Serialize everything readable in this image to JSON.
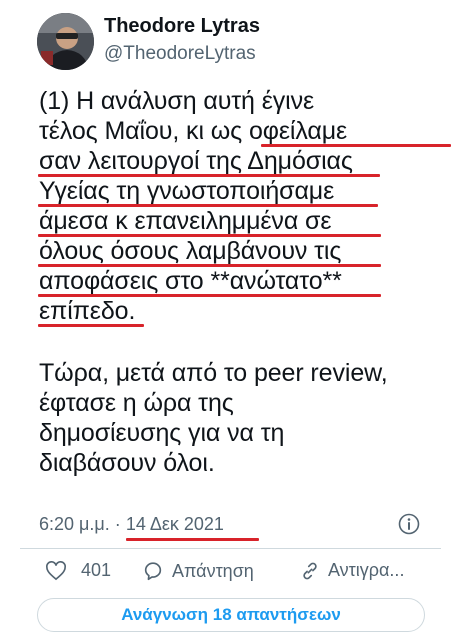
{
  "author": {
    "display_name": "Theodore Lytras",
    "handle": "@TheodoreLytras",
    "avatar_icon": "profile-photo"
  },
  "tweet": {
    "lines": [
      "(1) Η ανάλυση αυτή έγινε",
      "τέλος Μαΐου, κι ως οφείλαμε",
      "σαν λειτουργοί της Δημόσιας",
      "Υγείας τη γνωστοποιήσαμε",
      "άμεσα κ επανειλημμένα σε",
      "όλους όσους λαμβάνουν τις",
      "αποφάσεις στο **ανώτατο**",
      "επίπεδο.",
      "Τώρα, μετά από το peer review,",
      "έφτασε η ώρα της",
      "δημοσίευσης για να τη",
      "διαβάσουν όλοι."
    ],
    "time": "6:20 μ.μ.",
    "separator": "·",
    "date": "14 Δεκ 2021"
  },
  "actions": {
    "like_count": "401",
    "reply_label": "Απάντηση",
    "copy_label": "Αντιγρα..."
  },
  "read_replies_label": "Ανάγνωση 18 απαντήσεων",
  "colors": {
    "accent": "#1d9bf0",
    "underline_red": "#d8232a",
    "secondary_text": "#536471"
  }
}
